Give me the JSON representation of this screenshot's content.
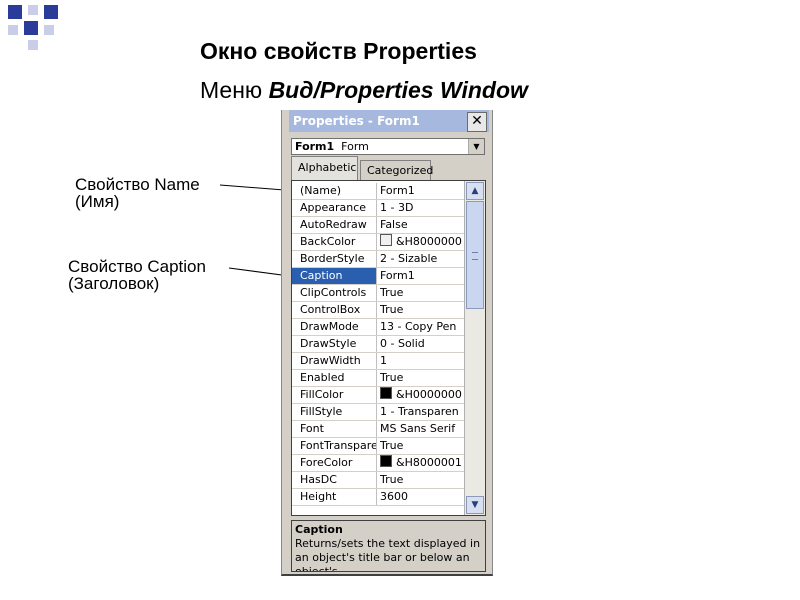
{
  "slide": {
    "title": "Окно свойств Properties",
    "subtitle_prefix": "Меню ",
    "subtitle_emphasis": "Вид/Properties Window"
  },
  "callouts": {
    "name": [
      "Свойство Name",
      "(Имя)"
    ],
    "caption": [
      "Свойство Caption",
      "(Заголовок)"
    ]
  },
  "window": {
    "title": "Properties - Form1",
    "close_label": "✕",
    "object_selector": {
      "name": "Form1",
      "type": "Form"
    },
    "tabs": [
      "Alphabetic",
      "Categorized"
    ],
    "active_tab": "Alphabetic",
    "properties": [
      {
        "name": "(Name)",
        "value": "Form1"
      },
      {
        "name": "Appearance",
        "value": "1 - 3D"
      },
      {
        "name": "AutoRedraw",
        "value": "False"
      },
      {
        "name": "BackColor",
        "value": "&H8000000",
        "swatch": "#f0f0f0"
      },
      {
        "name": "BorderStyle",
        "value": "2 - Sizable"
      },
      {
        "name": "Caption",
        "value": "Form1",
        "selected": true
      },
      {
        "name": "ClipControls",
        "value": "True"
      },
      {
        "name": "ControlBox",
        "value": "True"
      },
      {
        "name": "DrawMode",
        "value": "13 - Copy Pen"
      },
      {
        "name": "DrawStyle",
        "value": "0 - Solid"
      },
      {
        "name": "DrawWidth",
        "value": "1"
      },
      {
        "name": "Enabled",
        "value": "True"
      },
      {
        "name": "FillColor",
        "value": "&H0000000",
        "swatch": "#000000"
      },
      {
        "name": "FillStyle",
        "value": "1 - Transparen"
      },
      {
        "name": "Font",
        "value": "MS Sans Serif"
      },
      {
        "name": "FontTransparent",
        "value": "True"
      },
      {
        "name": "ForeColor",
        "value": "&H8000001",
        "swatch": "#000000"
      },
      {
        "name": "HasDC",
        "value": "True"
      },
      {
        "name": "Height",
        "value": "3600"
      }
    ],
    "description": {
      "title": "Caption",
      "text": "Returns/sets the text displayed in an object's title bar or below an object's"
    }
  },
  "colors": {
    "accent_blue": "#2b3b9a",
    "selection": "#2a5fb0",
    "titlebar": "#a6b8dd"
  }
}
